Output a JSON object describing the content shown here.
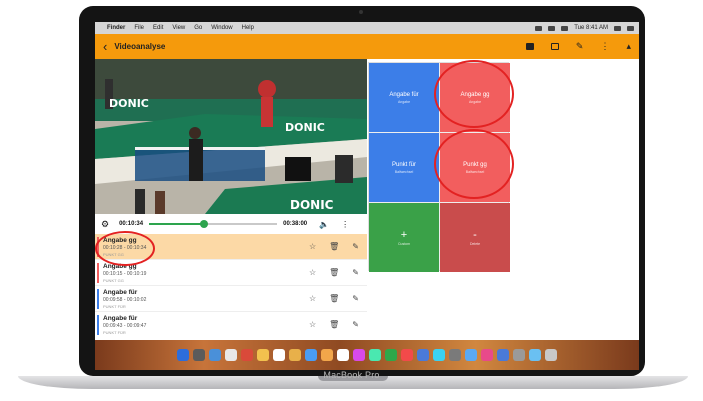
{
  "menubar": {
    "apple": "",
    "items": [
      "Finder",
      "File",
      "Edit",
      "View",
      "Go",
      "Window",
      "Help"
    ],
    "clock": "Tue 8:41 AM"
  },
  "appbar": {
    "back": "‹",
    "title": "Videoanalyse"
  },
  "video_controls": {
    "current_time": "00:10:34",
    "total_time": "00:38:00",
    "progress": 0.43
  },
  "events": [
    {
      "name": "Angabe gg",
      "time": "00:10:28 - 00:10:34",
      "tag": "PUNKT GG",
      "color": "#f25e5e",
      "selected": true
    },
    {
      "name": "Angabe gg",
      "time": "00:10:15 - 00:10:19",
      "tag": "PUNKT GG",
      "color": "#f25e5e",
      "selected": false
    },
    {
      "name": "Angabe für",
      "time": "00:09:58 - 00:10:02",
      "tag": "PUNKT FÜR",
      "color": "#3c7ee8",
      "selected": false
    },
    {
      "name": "Angabe für",
      "time": "00:09:43 - 00:09:47",
      "tag": "PUNKT FÜR",
      "color": "#3c7ee8",
      "selected": false
    }
  ],
  "tiles": [
    {
      "label": "Angabe für",
      "sub": "Angabe",
      "color": "blue"
    },
    {
      "label": "Angabe gg",
      "sub": "Angabe",
      "color": "red"
    },
    {
      "label": "Punkt für",
      "sub": "Ballwechsel",
      "color": "blue"
    },
    {
      "label": "Punkt gg",
      "sub": "Ballwechsel",
      "color": "red"
    },
    {
      "label": "Custom",
      "symbol": "+",
      "color": "green"
    },
    {
      "label": "Delete",
      "symbol": "-",
      "color": "dred"
    }
  ],
  "video_scene_text": "DONIC",
  "laptop_label": "MacBook Pro"
}
